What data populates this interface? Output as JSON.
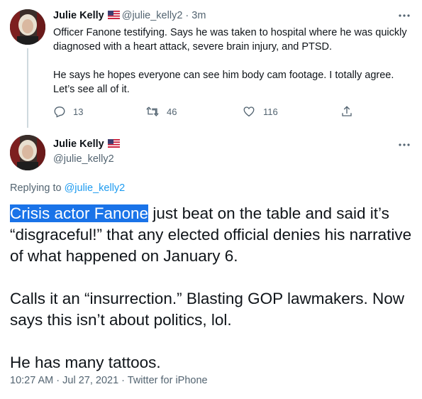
{
  "tweet1": {
    "author_name": "Julie Kelly",
    "flag_emoji": "🇺🇸",
    "handle": "@julie_kelly2",
    "separator": "·",
    "time": "3m",
    "paragraph1": "Officer Fanone testifying. Says he was taken to hospital where he was quickly diagnosed with a heart attack, severe brain injury, and PTSD.",
    "paragraph2": "He says he hopes everyone can see him body cam footage. I totally agree. Let’s see all of it.",
    "reply_count": "13",
    "retweet_count": "46",
    "like_count": "116",
    "icons": [
      "reply-icon",
      "retweet-icon",
      "like-icon",
      "share-icon",
      "more-icon"
    ]
  },
  "tweet2": {
    "author_name": "Julie Kelly",
    "flag_emoji": "🇺🇸",
    "handle": "@julie_kelly2",
    "replying_prefix": "Replying to",
    "replying_handle": "@julie_kelly2",
    "highlighted_text": "Crisis actor Fanone",
    "paragraph1_rest": " just beat on the table and said it’s “disgraceful!” that any elected official denies his narrative of what happened on January 6.",
    "paragraph2": "Calls it an “insurrection.” Blasting GOP lawmakers. Now says this isn’t about politics, lol.",
    "paragraph3": "He has many tattoos.",
    "footer": "10:27 AM · Jul 27, 2021 · Twitter for iPhone"
  },
  "colors": {
    "text": "#0f1419",
    "secondary": "#536471",
    "link": "#1d9bf0",
    "selection": "#1a73e8",
    "thread_line": "#cfd9de"
  }
}
